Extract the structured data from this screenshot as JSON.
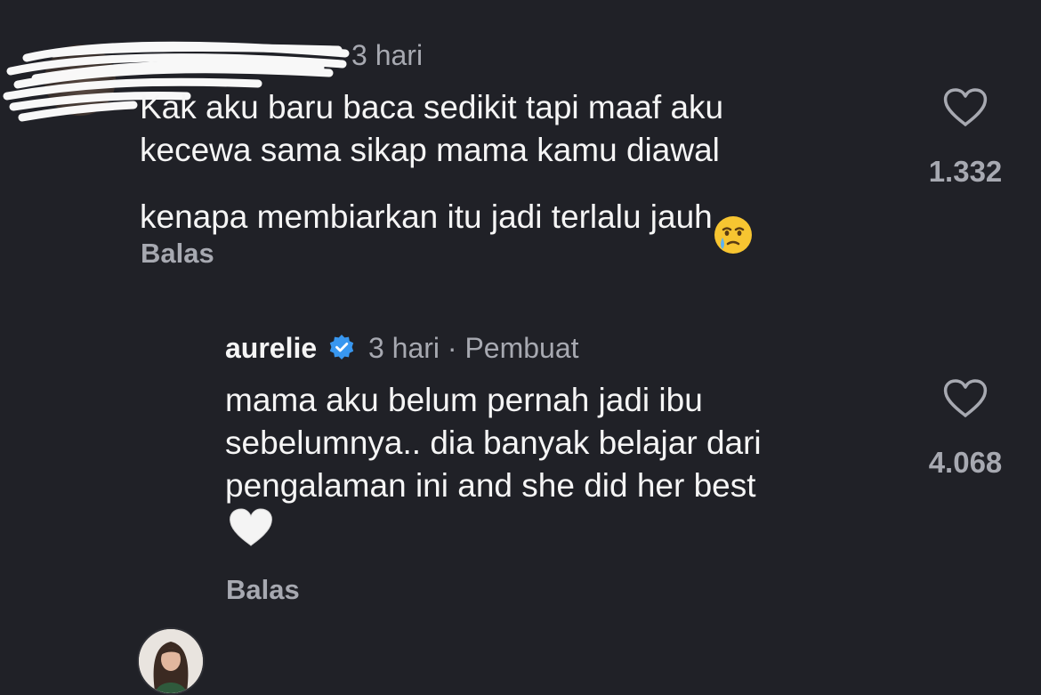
{
  "comments": [
    {
      "time": "3 hari",
      "text": "Kak aku baru baca sedikit tapi maaf aku\nkecewa sama sikap mama kamu diawal\nkenapa membiarkan itu jadi terlalu jauh",
      "emoji": "crying-face-icon",
      "reply_label": "Balas",
      "likes": "1.332"
    },
    {
      "username": "aurelie",
      "verified": true,
      "time": "3 hari",
      "separator": "·",
      "creator_label": "Pembuat",
      "text": "mama aku belum pernah jadi ibu\nsebelumnya.. dia banyak belajar dari\npengalaman ini and she did her best",
      "emoji": "white-heart-icon",
      "reply_label": "Balas",
      "likes": "4.068"
    }
  ],
  "colors": {
    "background": "#202127",
    "primary_text": "#f5f5f5",
    "secondary_text": "#a7a9b1",
    "verified_badge": "#3897f0"
  }
}
